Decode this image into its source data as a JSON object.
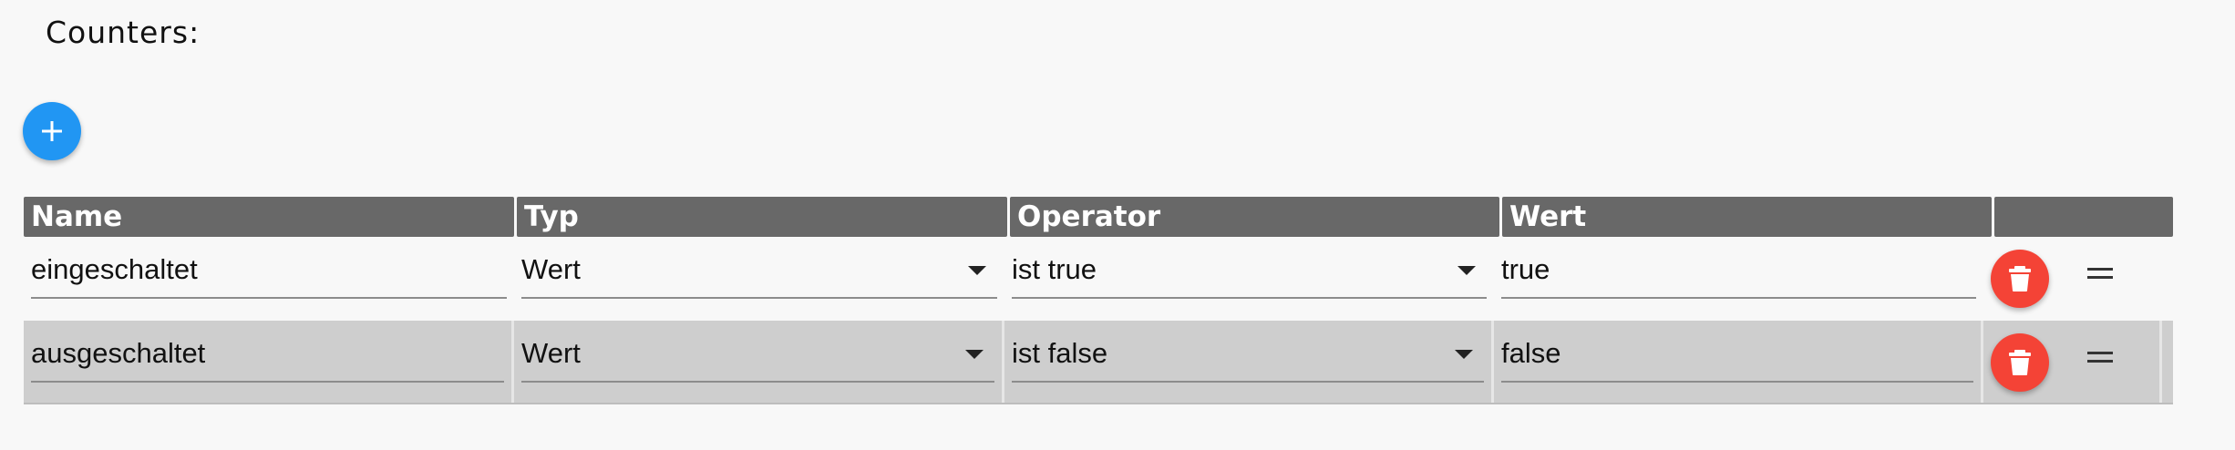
{
  "section": {
    "title": "Counters:"
  },
  "add_button": {
    "icon": "plus-icon",
    "color": "#2196f3"
  },
  "table": {
    "headers": [
      "Name",
      "Typ",
      "Operator",
      "Wert",
      ""
    ],
    "rows": [
      {
        "name": "eingeschaltet",
        "typ": "Wert",
        "operator": "ist true",
        "wert": "true"
      },
      {
        "name": "ausgeschaltet",
        "typ": "Wert",
        "operator": "ist false",
        "wert": "false"
      }
    ]
  },
  "colors": {
    "header_bg": "#686868",
    "delete_button": "#f44336",
    "alt_row_bg": "#cecece"
  },
  "icons": {
    "delete": "trash-icon",
    "drag": "drag-handle-icon",
    "select_arrow": "chevron-down-icon"
  }
}
